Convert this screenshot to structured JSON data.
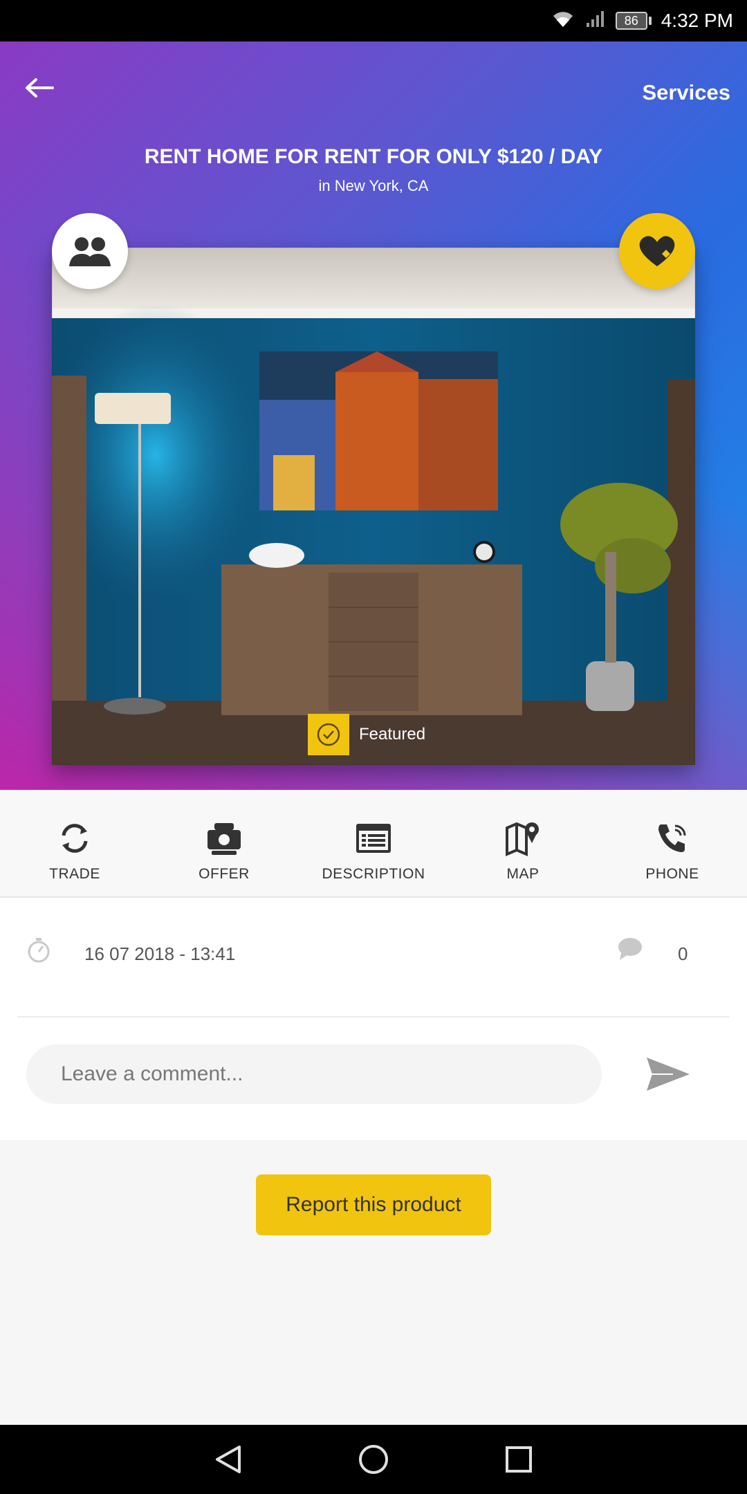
{
  "status_bar": {
    "battery": "86",
    "time": "4:32 PM"
  },
  "header": {
    "services_label": "Services",
    "title": "RENT HOME FOR RENT FOR ONLY $120 / DAY",
    "location": "in New York, CA"
  },
  "listing": {
    "featured_label": "Featured"
  },
  "actions": [
    {
      "label": "TRADE",
      "icon": "sync-icon"
    },
    {
      "label": "OFFER",
      "icon": "money-hand-icon"
    },
    {
      "label": "DESCRIPTION",
      "icon": "description-icon"
    },
    {
      "label": "MAP",
      "icon": "map-pin-icon"
    },
    {
      "label": "PHONE",
      "icon": "phone-icon"
    }
  ],
  "meta": {
    "date": "16 07 2018 - 13:41",
    "comment_count": "0"
  },
  "comment": {
    "placeholder": "Leave a comment..."
  },
  "report": {
    "label": "Report this product"
  },
  "colors": {
    "accent": "#f1c40f",
    "gradient_start": "#8a3bc4",
    "gradient_end": "#1e8fea",
    "pink": "#d21ca0"
  }
}
